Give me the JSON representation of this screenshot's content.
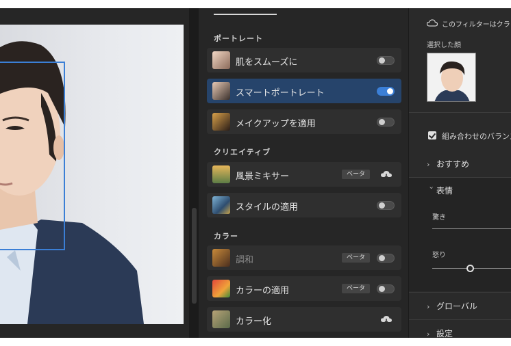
{
  "portrait_section": {
    "title": "ポートレート"
  },
  "creative_section": {
    "title": "クリエイティブ"
  },
  "color_section": {
    "title": "カラー"
  },
  "filters": {
    "smooth_skin": {
      "label": "肌をスムーズに",
      "enabled": false
    },
    "smart_portrait": {
      "label": "スマートポートレート",
      "enabled": true
    },
    "makeup_transfer": {
      "label": "メイクアップを適用",
      "enabled": false
    },
    "landscape_mixer": {
      "label": "風景ミキサー",
      "badge": "ベータ"
    },
    "style_transfer": {
      "label": "スタイルの適用",
      "enabled": false
    },
    "harmonization": {
      "label": "調和",
      "badge": "ベータ",
      "enabled": false
    },
    "color_transfer": {
      "label": "カラーの適用",
      "badge": "ベータ",
      "enabled": false
    },
    "colorize": {
      "label": "カラー化"
    }
  },
  "properties": {
    "cloud_text": "このフィルターはクラウ",
    "selected_face_label": "選択した顔",
    "balance_label": "組み合わせのバランス",
    "recommended": "おすすめ",
    "expression": "表情",
    "surprise": "驚き",
    "anger": "怒り",
    "global": "グローバル",
    "settings": "設定"
  },
  "sliders": {
    "anger": 0.5
  },
  "colors": {
    "accent": "#3b7fd6",
    "selected_row": "#26446b",
    "panel": "#262626"
  }
}
